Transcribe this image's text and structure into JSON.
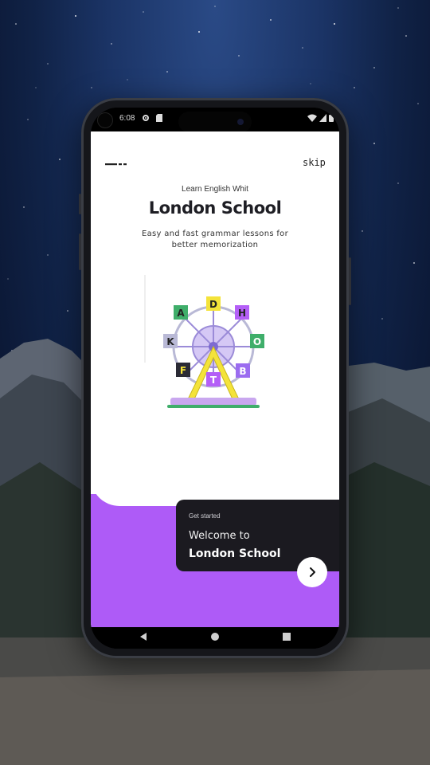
{
  "status": {
    "time": "6:08"
  },
  "header": {
    "skip_label": "skip"
  },
  "intro": {
    "subtitle": "Learn English Whit",
    "title": "London School",
    "description": "Easy and fast grammar lessons for better memorization"
  },
  "illustration": {
    "letters": [
      "D",
      "H",
      "O",
      "B",
      "T",
      "F",
      "K",
      "A"
    ]
  },
  "card": {
    "label": "Get started",
    "welcome": "Welcome to",
    "school": "London School"
  },
  "colors": {
    "accent": "#ae5bf7",
    "card_bg": "#1b1a20",
    "title": "#1e1e24"
  },
  "icons": {
    "menu": "menu-icon",
    "next": "chevron-right-icon",
    "nav_back": "triangle-back-icon",
    "nav_home": "circle-home-icon",
    "nav_recents": "square-recents-icon"
  }
}
